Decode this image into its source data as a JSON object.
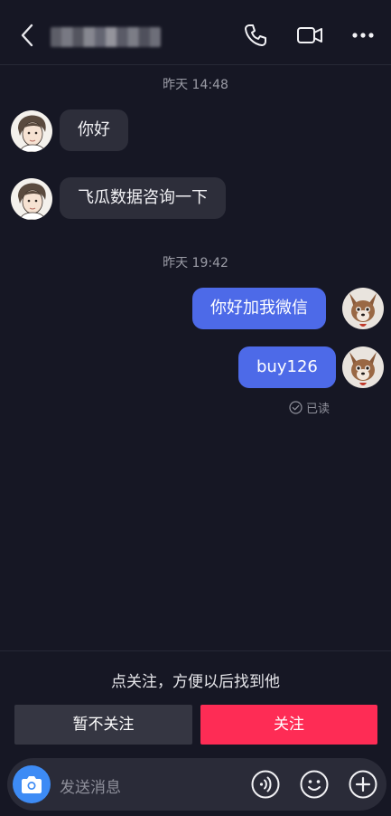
{
  "header": {
    "contact_name": "████████",
    "icons": [
      "back-icon",
      "phone-icon",
      "video-call-icon",
      "more-icon"
    ]
  },
  "messages": {
    "timestamp1": "昨天 14:48",
    "in1": "你好",
    "in2": "飞瓜数据咨询一下",
    "timestamp2": "昨天 19:42",
    "out1": "你好加我微信",
    "out2": "buy126",
    "read_status": "已读"
  },
  "follow_panel": {
    "prompt": "点关注，方便以后找到他",
    "skip_label": "暂不关注",
    "follow_label": "关注"
  },
  "input_bar": {
    "placeholder": "发送消息",
    "icons": [
      "camera-icon",
      "voice-icon",
      "emoji-icon",
      "plus-icon"
    ]
  },
  "colors": {
    "background": "#161724",
    "incoming_bubble": "#2d2e3a",
    "outgoing_bubble": "#4d6ae8",
    "follow_button": "#fe2c55",
    "camera_button": "#3d8bf5"
  }
}
